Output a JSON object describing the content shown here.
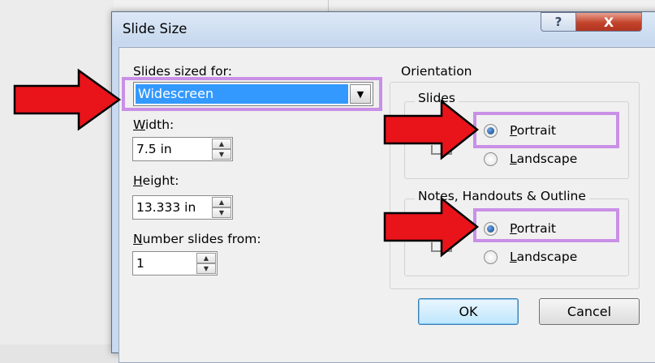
{
  "dialog": {
    "title": "Slide Size",
    "help_glyph": "?",
    "close_glyph": "X"
  },
  "left": {
    "slides_sized_for_label": "Slides sized for:",
    "slides_sized_for_value": "Widescreen",
    "width_label_accel": "W",
    "width_label_rest": "idth:",
    "width_value": "7.5 in",
    "height_label_accel": "H",
    "height_label_rest": "eight:",
    "height_value": "13.333 in",
    "number_label_accel": "N",
    "number_label_rest": "umber slides from:",
    "number_value": "1"
  },
  "orientation": {
    "title": "Orientation",
    "slides": {
      "title": "Slides",
      "portrait_accel": "P",
      "portrait_rest": "ortrait",
      "landscape_accel": "L",
      "landscape_rest": "andscape",
      "selected": "portrait"
    },
    "notes": {
      "title": "Notes, Handouts & Outline",
      "portrait_accel": "P",
      "portrait_rest": "ortrait",
      "landscape_accel": "L",
      "landscape_rest": "andscape",
      "selected": "portrait"
    }
  },
  "buttons": {
    "ok": "OK",
    "cancel": "Cancel"
  },
  "annotations": {
    "highlight_color": "#c990e6",
    "arrow_color": "#e8141a"
  },
  "icons": {
    "dropdown": "chevron-down-icon",
    "spin_up": "chevron-up-icon",
    "spin_down": "chevron-down-icon"
  }
}
